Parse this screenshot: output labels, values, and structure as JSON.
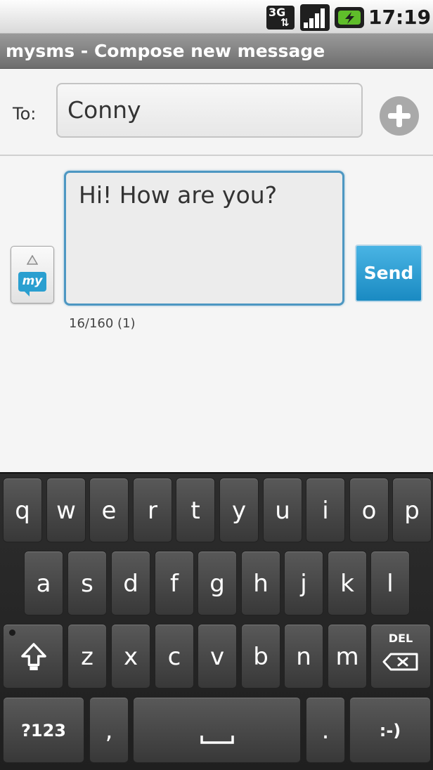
{
  "status_bar": {
    "network": "3G",
    "time": "17:19"
  },
  "title_bar": {
    "title": "mysms - Compose new message"
  },
  "recipient": {
    "label": "To:",
    "value": "Conny"
  },
  "compose": {
    "message": "Hi! How are you?",
    "send_label": "Send",
    "counter": "16/160 (1)",
    "attach_logo": "my"
  },
  "keyboard": {
    "row1": [
      "q",
      "w",
      "e",
      "r",
      "t",
      "y",
      "u",
      "i",
      "o",
      "p"
    ],
    "row2": [
      "a",
      "s",
      "d",
      "f",
      "g",
      "h",
      "j",
      "k",
      "l"
    ],
    "row3": [
      "z",
      "x",
      "c",
      "v",
      "b",
      "n",
      "m"
    ],
    "del_label": "DEL",
    "symbols_label": "?123",
    "comma_label": ",",
    "period_label": ".",
    "smiley_label": ":-)"
  },
  "colors": {
    "accent": "#2a9fd0",
    "title_bar": "#7f7f7f",
    "keyboard": "#262626"
  }
}
